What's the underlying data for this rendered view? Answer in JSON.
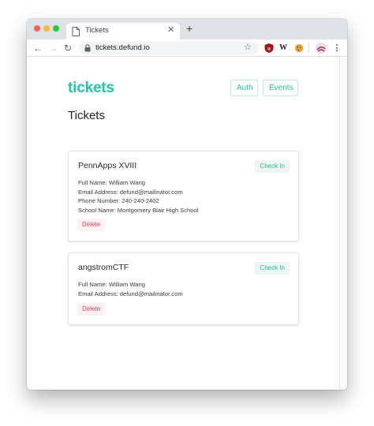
{
  "browser": {
    "tab_title": "Tickets",
    "url": "tickets.defund.io",
    "new_tab_symbol": "+",
    "close_symbol": "✕"
  },
  "extensions": {
    "wiki_label": "W"
  },
  "app": {
    "brand": "tickets",
    "nav": {
      "auth": "Auth",
      "events": "Events"
    },
    "page_title": "Tickets",
    "accent_color": "#1fc8a5",
    "danger_color": "#e0445c"
  },
  "tickets": [
    {
      "event": "PennApps XVIII",
      "check_in_label": "Check In",
      "delete_label": "Delete",
      "details": [
        "Full Name: William Wang",
        "Email Address: defund@mailinator.com",
        "Phone Number: 240-240-2402",
        "School Name: Montgomery Blair High School"
      ]
    },
    {
      "event": "angstromCTF",
      "check_in_label": "Check In",
      "delete_label": "Delete",
      "details": [
        "Full Name: William Wang",
        "Email Address: defund@mailinator.com"
      ]
    }
  ]
}
